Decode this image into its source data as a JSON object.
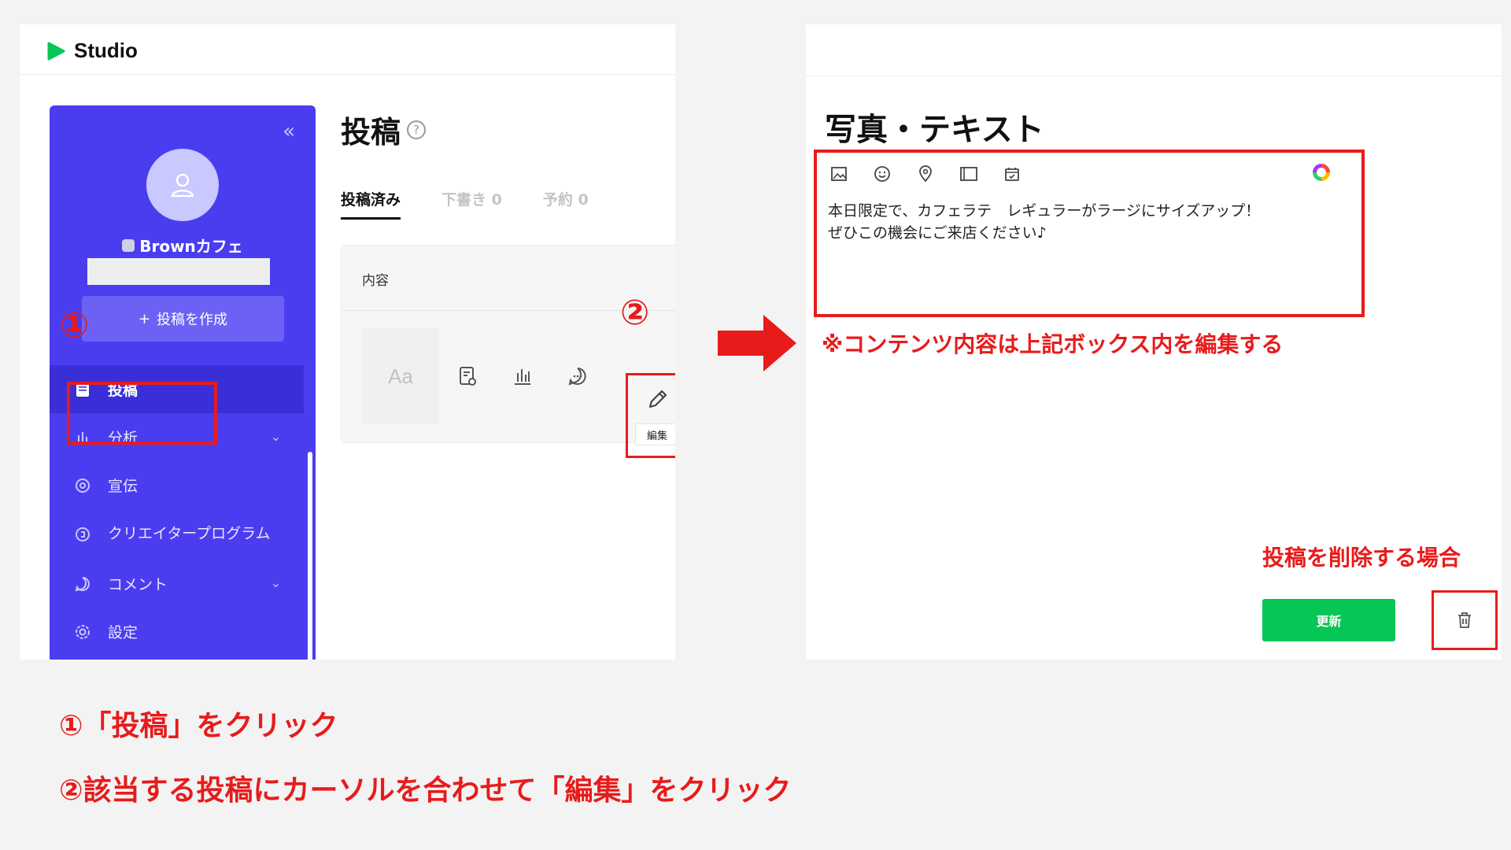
{
  "colors": {
    "annotation_red": "#e81b1b",
    "sidebar_blue": "#4a3df0",
    "update_green": "#06c755"
  },
  "left_screen": {
    "app_name": "Studio",
    "sidebar": {
      "account_name": "Brownカフェ",
      "create_button": "投稿を作成",
      "create_plus": "+",
      "collapse": "«",
      "items": [
        {
          "label": "投稿",
          "icon": "post-icon",
          "active": true
        },
        {
          "label": "分析",
          "icon": "analytics-icon",
          "chevron": "⌄"
        },
        {
          "label": "宣伝",
          "icon": "promotion-icon"
        },
        {
          "label": "クリエイタープログラム",
          "icon": "creator-program-icon"
        },
        {
          "label": "コメント",
          "icon": "comment-icon",
          "chevron": "⌄"
        },
        {
          "label": "設定",
          "icon": "settings-icon"
        }
      ]
    },
    "page_title": "投稿",
    "help": "?",
    "tabs": [
      {
        "label": "投稿済み",
        "active": true
      },
      {
        "label": "下書き 0"
      },
      {
        "label": "予約 0"
      }
    ],
    "card": {
      "column_header": "内容",
      "thumbnail_text": "Aa",
      "edit_tooltip": "編集"
    }
  },
  "markers": {
    "one": "①",
    "two": "②"
  },
  "right_screen": {
    "editor_title": "写真・テキスト",
    "toolbar_icons": [
      "image-icon",
      "emoji-icon",
      "location-icon",
      "frame-icon",
      "coupon-icon"
    ],
    "editor_text": "本日限定で、カフェラテ　レギュラーがラージにサイズアップ！\nぜひこの機会にご来店ください♪",
    "note": "※コンテンツ内容は上記ボックス内を編集する",
    "delete_label": "投稿を削除する場合",
    "update_button": "更新"
  },
  "instructions": {
    "step1": "①「投稿」をクリック",
    "step2": "②該当する投稿にカーソルを合わせて「編集」をクリック"
  }
}
